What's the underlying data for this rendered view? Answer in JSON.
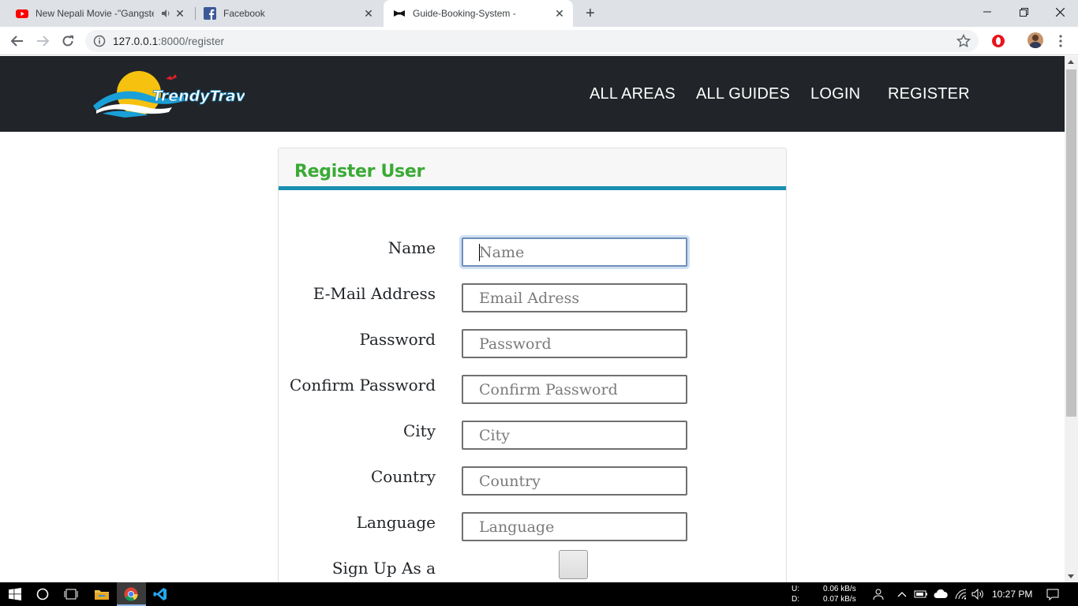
{
  "browser": {
    "tabs": [
      {
        "title": "New Nepali Movie -\"Gangste",
        "favicon": "youtube-icon",
        "audio": true
      },
      {
        "title": "Facebook",
        "favicon": "facebook-icon"
      },
      {
        "title": "Guide-Booking-System -",
        "favicon": "bowtie-icon",
        "active": true
      }
    ],
    "url_host": "127.0.0.1",
    "url_rest": ":8000/register"
  },
  "site": {
    "logo_text": "TrendyTravel",
    "nav": [
      "ALL AREAS",
      "ALL GUIDES",
      "LOGIN",
      "REGISTER"
    ]
  },
  "form": {
    "title": "Register User",
    "fields": [
      {
        "label": "Name",
        "placeholder": "Name"
      },
      {
        "label": "E-Mail Address",
        "placeholder": "Email Adress"
      },
      {
        "label": "Password",
        "placeholder": "Password"
      },
      {
        "label": "Confirm Password",
        "placeholder": "Confirm Password"
      },
      {
        "label": "City",
        "placeholder": "City"
      },
      {
        "label": "Country",
        "placeholder": "Country"
      },
      {
        "label": "Language",
        "placeholder": "Language"
      }
    ],
    "signup_label": "Sign Up As a"
  },
  "taskbar": {
    "upload_label": "U:",
    "download_label": "D:",
    "upload_speed": "0.06 kB/s",
    "download_speed": "0.07 kB/s",
    "time": "10:27 PM"
  },
  "colors": {
    "nav_bg": "#212529",
    "title_green": "#3aaa35",
    "header_rule": "#1a8fb0"
  }
}
